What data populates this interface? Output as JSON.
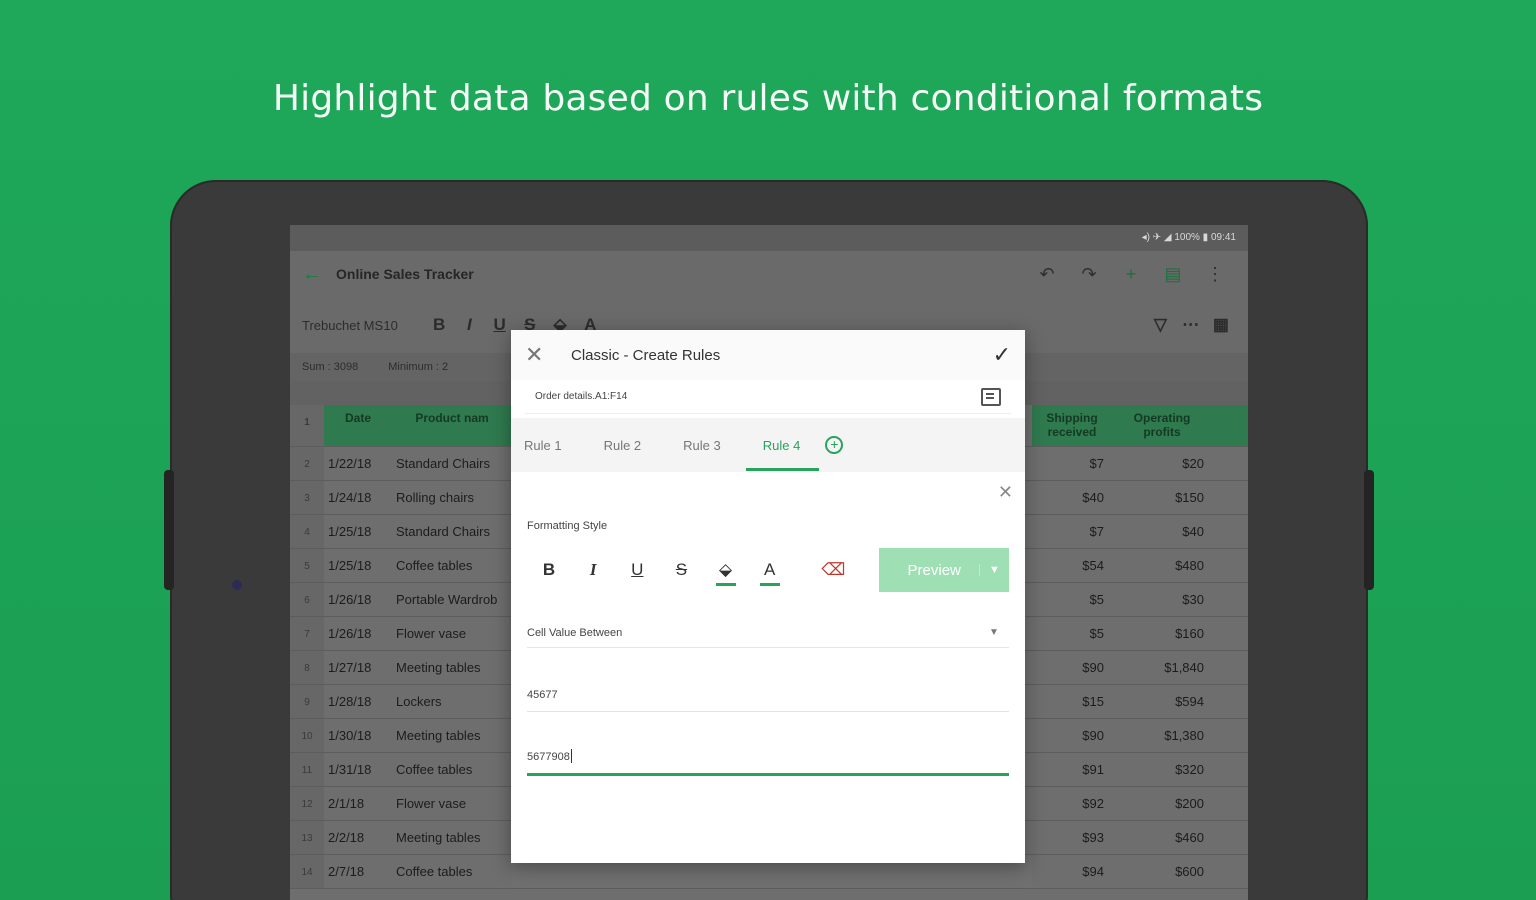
{
  "headline": "Highlight data based on rules with conditional formats",
  "colors": {
    "background": "#1fa557",
    "accent": "#27a35c",
    "preview_bg": "#9ee0b4"
  },
  "status_bar": {
    "text": "◂) ✈ ◢ 100% ▮ 09:41"
  },
  "app": {
    "title": "Online Sales Tracker",
    "toolbar": {
      "font": "Trebuchet MS",
      "size": "10",
      "bold": "B",
      "italic": "I",
      "underline": "U",
      "strike": "S",
      "fill": "⬙",
      "color": "A"
    },
    "formula_bar": {
      "sum": "Sum : 3098",
      "min": "Minimum : 2"
    }
  },
  "sheet": {
    "headers": {
      "date": "Date",
      "product": "Product nam",
      "shipping": "Shipping received",
      "profits": "Operating profits"
    },
    "rows": [
      {
        "n": "2",
        "date": "1/22/18",
        "product": "Standard Chairs",
        "ship": "$7",
        "profit": "$20"
      },
      {
        "n": "3",
        "date": "1/24/18",
        "product": "Rolling chairs",
        "ship": "$40",
        "profit": "$150"
      },
      {
        "n": "4",
        "date": "1/25/18",
        "product": "Standard Chairs",
        "ship": "$7",
        "profit": "$40"
      },
      {
        "n": "5",
        "date": "1/25/18",
        "product": "Coffee tables",
        "ship": "$54",
        "profit": "$480"
      },
      {
        "n": "6",
        "date": "1/26/18",
        "product": "Portable Wardrob",
        "ship": "$5",
        "profit": "$30"
      },
      {
        "n": "7",
        "date": "1/26/18",
        "product": "Flower vase",
        "ship": "$5",
        "profit": "$160"
      },
      {
        "n": "8",
        "date": "1/27/18",
        "product": "Meeting tables",
        "ship": "$90",
        "profit": "$1,840"
      },
      {
        "n": "9",
        "date": "1/28/18",
        "product": "Lockers",
        "ship": "$15",
        "profit": "$594"
      },
      {
        "n": "10",
        "date": "1/30/18",
        "product": "Meeting tables",
        "ship": "$90",
        "profit": "$1,380"
      },
      {
        "n": "11",
        "date": "1/31/18",
        "product": "Coffee tables",
        "ship": "$91",
        "profit": "$320"
      },
      {
        "n": "12",
        "date": "2/1/18",
        "product": "Flower vase",
        "ship": "$92",
        "profit": "$200"
      },
      {
        "n": "13",
        "date": "2/2/18",
        "product": "Meeting tables",
        "ship": "$93",
        "profit": "$460"
      },
      {
        "n": "14",
        "date": "2/7/18",
        "product": "Coffee tables",
        "ship": "$94",
        "profit": "$600"
      }
    ]
  },
  "dialog": {
    "title": "Classic - Create Rules",
    "range": "Order details.A1:F14",
    "tabs": [
      "Rule 1",
      "Rule 2",
      "Rule 3",
      "Rule 4"
    ],
    "active_tab": "Rule 4",
    "formatting_label": "Formatting Style",
    "style_buttons": {
      "bold": "B",
      "italic": "I",
      "underline": "U",
      "strike": "S",
      "fill": "⬙",
      "font_color": "A",
      "clear": "⌫"
    },
    "preview_label": "Preview",
    "condition": "Cell Value Between",
    "value1": "45677",
    "value2": "5677908"
  }
}
